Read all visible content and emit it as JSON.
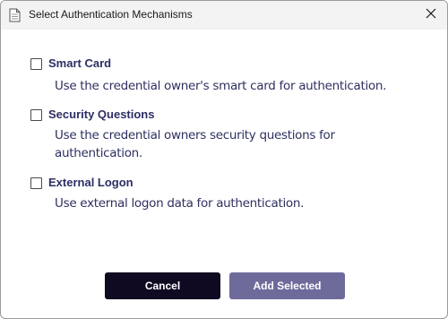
{
  "window": {
    "title": "Select Authentication Mechanisms"
  },
  "options": [
    {
      "label": "Smart Card",
      "description": "Use the credential owner's smart card for authentication.",
      "checked": false
    },
    {
      "label": "Security Questions",
      "description": "Use the credential owners security questions for authentication.",
      "checked": false
    },
    {
      "label": "External Logon",
      "description": "Use external logon data for authentication.",
      "checked": false
    }
  ],
  "buttons": {
    "cancel_label": "Cancel",
    "add_label": "Add Selected"
  },
  "colors": {
    "label_text": "#2c2e64",
    "cancel_bg": "#0f0a21",
    "add_bg": "#6e6b9b",
    "titlebar_bg": "#f3f3f3"
  },
  "icons": {
    "title": "document-icon",
    "close": "close-icon"
  }
}
